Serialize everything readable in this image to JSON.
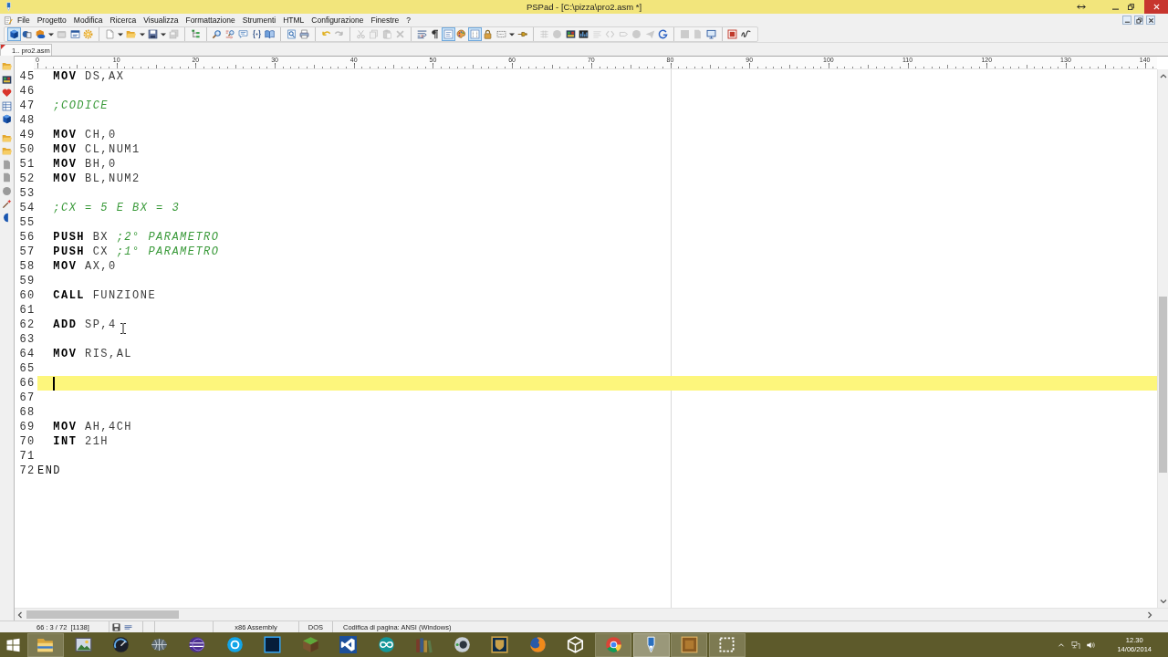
{
  "window": {
    "title": "PSPad - [C:\\pizza\\pro2.asm *]"
  },
  "menu": [
    "File",
    "Progetto",
    "Modifica",
    "Ricerca",
    "Visualizza",
    "Formattazione",
    "Strumenti",
    "HTML",
    "Configurazione",
    "Finestre",
    "?"
  ],
  "toolbar": [
    [
      {
        "kind": "cube",
        "pressed": true,
        "disabled": false,
        "dropdown": false
      },
      {
        "kind": "shapes",
        "pressed": false,
        "disabled": false,
        "dropdown": false
      },
      {
        "kind": "cubedisk",
        "pressed": false,
        "disabled": false,
        "dropdown": true
      },
      {
        "kind": "wingray",
        "pressed": false,
        "disabled": true,
        "dropdown": false
      },
      {
        "kind": "window",
        "pressed": false,
        "disabled": false,
        "dropdown": false
      },
      {
        "kind": "gear",
        "pressed": false,
        "disabled": false,
        "dropdown": false
      }
    ],
    [
      {
        "kind": "document",
        "pressed": false,
        "disabled": false,
        "dropdown": true
      },
      {
        "kind": "folder",
        "pressed": false,
        "disabled": false,
        "dropdown": true
      },
      {
        "kind": "floppy",
        "pressed": false,
        "disabled": false,
        "dropdown": true
      },
      {
        "kind": "floppies",
        "pressed": false,
        "disabled": true,
        "dropdown": false
      }
    ],
    [
      {
        "kind": "tree",
        "pressed": false,
        "disabled": false,
        "dropdown": false
      }
    ],
    [
      {
        "kind": "search",
        "pressed": false,
        "disabled": false,
        "dropdown": false
      },
      {
        "kind": "replace",
        "pressed": false,
        "disabled": false,
        "dropdown": false
      },
      {
        "kind": "comment",
        "pressed": false,
        "disabled": false,
        "dropdown": false
      },
      {
        "kind": "braces",
        "pressed": false,
        "disabled": false,
        "dropdown": false
      },
      {
        "kind": "book",
        "pressed": false,
        "disabled": false,
        "dropdown": false
      }
    ],
    [
      {
        "kind": "preview",
        "pressed": false,
        "disabled": false,
        "dropdown": false
      },
      {
        "kind": "printer",
        "pressed": false,
        "disabled": false,
        "dropdown": false
      }
    ],
    [
      {
        "kind": "undo",
        "pressed": false,
        "disabled": false,
        "dropdown": false
      },
      {
        "kind": "redo",
        "pressed": false,
        "disabled": true,
        "dropdown": false
      }
    ],
    [
      {
        "kind": "scissors",
        "pressed": false,
        "disabled": true,
        "dropdown": false
      },
      {
        "kind": "copy",
        "pressed": false,
        "disabled": true,
        "dropdown": false
      },
      {
        "kind": "paste",
        "pressed": false,
        "disabled": true,
        "dropdown": false
      },
      {
        "kind": "cross",
        "pressed": false,
        "disabled": true,
        "dropdown": false
      }
    ],
    [
      {
        "kind": "wrap",
        "pressed": false,
        "disabled": false,
        "dropdown": false
      },
      {
        "kind": "pilcrow",
        "pressed": false,
        "disabled": false,
        "dropdown": false
      },
      {
        "kind": "textbox",
        "pressed": true,
        "disabled": false,
        "dropdown": false
      },
      {
        "kind": "palette",
        "pressed": false,
        "disabled": false,
        "dropdown": false
      },
      {
        "kind": "columns",
        "pressed": true,
        "disabled": false,
        "dropdown": false
      },
      {
        "kind": "lock",
        "pressed": false,
        "disabled": false,
        "dropdown": false
      },
      {
        "kind": "dots",
        "pressed": false,
        "disabled": false,
        "dropdown": true
      },
      {
        "kind": "pin",
        "pressed": false,
        "disabled": false,
        "dropdown": false
      }
    ],
    [
      {
        "kind": "grid",
        "pressed": false,
        "disabled": true,
        "dropdown": false
      },
      {
        "kind": "circle",
        "pressed": false,
        "disabled": true,
        "dropdown": false
      },
      {
        "kind": "picture",
        "pressed": false,
        "disabled": false,
        "dropdown": false
      },
      {
        "kind": "bars",
        "pressed": false,
        "disabled": false,
        "dropdown": false
      },
      {
        "kind": "smalltext",
        "pressed": false,
        "disabled": true,
        "dropdown": false
      },
      {
        "kind": "brackets",
        "pressed": false,
        "disabled": true,
        "dropdown": false
      },
      {
        "kind": "tag",
        "pressed": false,
        "disabled": true,
        "dropdown": false
      },
      {
        "kind": "circle",
        "pressed": false,
        "disabled": true,
        "dropdown": false
      },
      {
        "kind": "plane",
        "pressed": false,
        "disabled": true,
        "dropdown": false
      },
      {
        "kind": "arc",
        "pressed": false,
        "disabled": false,
        "dropdown": false
      }
    ],
    [
      {
        "kind": "square",
        "pressed": false,
        "disabled": true,
        "dropdown": false
      },
      {
        "kind": "page",
        "pressed": false,
        "disabled": true,
        "dropdown": false
      },
      {
        "kind": "monitor",
        "pressed": false,
        "disabled": false,
        "dropdown": false
      }
    ],
    [
      {
        "kind": "redbox",
        "pressed": false,
        "disabled": false,
        "dropdown": false
      },
      {
        "kind": "go",
        "pressed": false,
        "disabled": false,
        "dropdown": false
      }
    ]
  ],
  "tabs": [
    {
      "label": "1.. pro2.asm",
      "selected": true,
      "modified": true
    }
  ],
  "ruler": [
    "0",
    "10",
    "20",
    "30",
    "40",
    "50",
    "60",
    "70",
    "80",
    "90",
    "100",
    "110",
    "120",
    "130",
    "140"
  ],
  "editor": {
    "lines": [
      {
        "number": "45",
        "current": false,
        "indented": true,
        "tokens": [
          {
            "kind": "keyword",
            "text": "MOV"
          },
          {
            "kind": "operand",
            "text": "DS,AX"
          }
        ]
      },
      {
        "number": "46",
        "current": false
      },
      {
        "number": "47",
        "current": false,
        "indented": true,
        "tokens": [
          {
            "kind": "comment",
            "text": ";CODICE"
          }
        ]
      },
      {
        "number": "48",
        "current": false
      },
      {
        "number": "49",
        "current": false,
        "indented": true,
        "tokens": [
          {
            "kind": "keyword",
            "text": "MOV"
          },
          {
            "kind": "operand",
            "text": "CH,0"
          }
        ]
      },
      {
        "number": "50",
        "current": false,
        "indented": true,
        "tokens": [
          {
            "kind": "keyword",
            "text": "MOV"
          },
          {
            "kind": "operand",
            "text": "CL,NUM1"
          }
        ]
      },
      {
        "number": "51",
        "current": false,
        "indented": true,
        "tokens": [
          {
            "kind": "keyword",
            "text": "MOV"
          },
          {
            "kind": "operand",
            "text": "BH,0"
          }
        ]
      },
      {
        "number": "52",
        "current": false,
        "indented": true,
        "tokens": [
          {
            "kind": "keyword",
            "text": "MOV"
          },
          {
            "kind": "operand",
            "text": "BL,NUM2"
          }
        ]
      },
      {
        "number": "53",
        "current": false
      },
      {
        "number": "54",
        "current": false,
        "indented": true,
        "tokens": [
          {
            "kind": "comment",
            "text": ";CX = 5 E BX = 3"
          }
        ]
      },
      {
        "number": "55",
        "current": false
      },
      {
        "number": "56",
        "current": false,
        "indented": true,
        "tokens": [
          {
            "kind": "keyword",
            "text": "PUSH"
          },
          {
            "kind": "operand",
            "text": "BX"
          },
          {
            "kind": "comment",
            "text": ";2° PARAMETRO"
          }
        ]
      },
      {
        "number": "57",
        "current": false,
        "indented": true,
        "tokens": [
          {
            "kind": "keyword",
            "text": "PUSH"
          },
          {
            "kind": "operand",
            "text": "CX"
          },
          {
            "kind": "comment",
            "text": ";1° PARAMETRO"
          }
        ]
      },
      {
        "number": "58",
        "current": false,
        "indented": true,
        "tokens": [
          {
            "kind": "keyword",
            "text": "MOV"
          },
          {
            "kind": "operand",
            "text": "AX,0"
          }
        ]
      },
      {
        "number": "59",
        "current": false
      },
      {
        "number": "60",
        "current": false,
        "indented": true,
        "tokens": [
          {
            "kind": "keyword",
            "text": "CALL"
          },
          {
            "kind": "operand",
            "text": "FUNZIONE"
          }
        ]
      },
      {
        "number": "61",
        "current": false
      },
      {
        "number": "62",
        "current": false,
        "indented": true,
        "tokens": [
          {
            "kind": "keyword",
            "text": "ADD"
          },
          {
            "kind": "operand",
            "text": "SP,4"
          }
        ]
      },
      {
        "number": "63",
        "current": false
      },
      {
        "number": "64",
        "current": false,
        "indented": true,
        "tokens": [
          {
            "kind": "keyword",
            "text": "MOV"
          },
          {
            "kind": "operand",
            "text": "RIS,AL"
          }
        ]
      },
      {
        "number": "65",
        "current": false
      },
      {
        "number": "66",
        "current": true,
        "indented": true
      },
      {
        "number": "67",
        "current": false
      },
      {
        "number": "68",
        "current": false
      },
      {
        "number": "69",
        "current": false,
        "indented": true,
        "tokens": [
          {
            "kind": "keyword",
            "text": "MOV"
          },
          {
            "kind": "operand",
            "text": "AH,4CH"
          }
        ]
      },
      {
        "number": "70",
        "current": false,
        "indented": true,
        "tokens": [
          {
            "kind": "keyword",
            "text": "INT"
          },
          {
            "kind": "operand",
            "text": "21H"
          }
        ]
      },
      {
        "number": "71",
        "current": false
      },
      {
        "number": "72",
        "current": false,
        "indented": false,
        "tokens": [
          {
            "kind": "directive",
            "text": "END"
          }
        ]
      }
    ]
  },
  "status_bar": {
    "position": "66 : 3 / 72  [1138]",
    "syntax": "x86 Assembly",
    "line_endings": "DOS",
    "encoding": "Codifica di pagina: ANSI (Windows)"
  },
  "taskbar": {
    "apps": [
      {
        "kind": "tfolder",
        "running": true,
        "active": false
      },
      {
        "kind": "viewer",
        "running": false,
        "active": false
      },
      {
        "kind": "gauge",
        "running": false,
        "active": false
      },
      {
        "kind": "wireglobe",
        "running": false,
        "active": false
      },
      {
        "kind": "sphere",
        "running": false,
        "active": false
      },
      {
        "kind": "ringbadge",
        "running": false,
        "active": false
      },
      {
        "kind": "pstile",
        "running": false,
        "active": false
      },
      {
        "kind": "block",
        "running": false,
        "active": false
      },
      {
        "kind": "bowtile",
        "running": false,
        "active": false
      },
      {
        "kind": "infinity",
        "running": false,
        "active": false
      },
      {
        "kind": "books",
        "running": false,
        "active": false
      },
      {
        "kind": "disc",
        "running": false,
        "active": false
      },
      {
        "kind": "shield",
        "running": false,
        "active": false
      },
      {
        "kind": "globe",
        "running": false,
        "active": false
      },
      {
        "kind": "cubeoutline",
        "running": false,
        "active": false
      },
      {
        "kind": "segcircle",
        "running": true,
        "active": false
      },
      {
        "kind": "nib",
        "running": true,
        "active": true
      },
      {
        "kind": "tile",
        "running": true,
        "active": false
      },
      {
        "kind": "dashsq",
        "running": true,
        "active": false
      }
    ],
    "clock": {
      "time": "12.30",
      "date": "14/06/2014"
    }
  }
}
